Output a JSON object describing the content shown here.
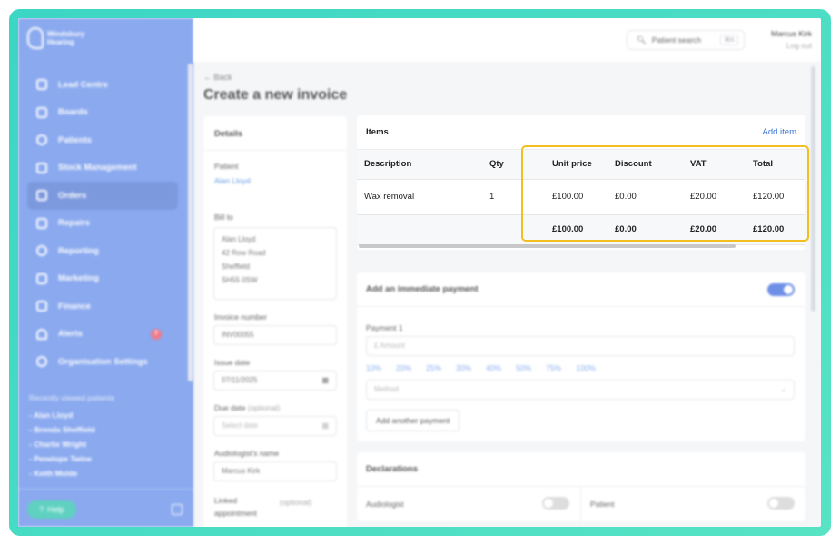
{
  "brand": {
    "name": "Windsbury Hearing",
    "line1": "Windsbury",
    "line2": "Hearing"
  },
  "colors": {
    "sidebar": "#8aa9ef",
    "accent": "#3b73d6",
    "highlight": "#f2c01e",
    "frame": "#3cd6c4"
  },
  "sidebar": {
    "items": [
      {
        "label": "Lead Centre",
        "icon": "headset-icon"
      },
      {
        "label": "Boards",
        "icon": "board-icon"
      },
      {
        "label": "Patients",
        "icon": "smile-icon"
      },
      {
        "label": "Stock Management",
        "icon": "box-icon"
      },
      {
        "label": "Orders",
        "icon": "calendar-icon",
        "active": true
      },
      {
        "label": "Repairs",
        "icon": "wrench-icon"
      },
      {
        "label": "Reporting",
        "icon": "pie-icon"
      },
      {
        "label": "Marketing",
        "icon": "mail-icon"
      },
      {
        "label": "Finance",
        "icon": "card-icon"
      },
      {
        "label": "Alerts",
        "icon": "bell-icon",
        "badge": "7"
      },
      {
        "label": "Organisation Settings",
        "icon": "gear-icon"
      }
    ],
    "recent_heading": "Recently viewed patients",
    "recent": [
      "- Alan Lloyd",
      "- Brenda Sheffield",
      "- Charlie Wright",
      "- Penelope Twine",
      "- Keith Molde"
    ],
    "help_label": "Help"
  },
  "header": {
    "search_label": "Patient search",
    "search_shortcut": "⌘K",
    "user_name": "Marcus Kirk",
    "logout_label": "Log out"
  },
  "page": {
    "back_label": "Back",
    "title": "Create a new invoice"
  },
  "details": {
    "heading": "Details",
    "patient_label": "Patient",
    "patient_value": "Alan Lloyd",
    "bill_to_label": "Bill to",
    "bill_to_lines": [
      "Alan Lloyd",
      "42 Row Road",
      "Sheffield",
      "SH55 0SW"
    ],
    "invoice_number_label": "Invoice number",
    "invoice_number": "INV00055",
    "issue_date_label": "Issue date",
    "issue_date": "07/11/2025",
    "due_date_label": "Due date",
    "due_date_optional": "(optional)",
    "due_date_placeholder": "Select date",
    "audiologist_label": "Audiologist's name",
    "audiologist": "Marcus Kirk",
    "linked_label": "Linked appointment",
    "linked_optional": "(optional)"
  },
  "items": {
    "heading": "Items",
    "add_label": "Add item",
    "columns": [
      "Description",
      "Qty",
      "Unit price",
      "Discount",
      "VAT",
      "Total"
    ],
    "rows": [
      {
        "description": "Wax removal",
        "qty": "1",
        "unit_price": "£100.00",
        "discount": "£0.00",
        "vat": "£20.00",
        "total": "£120.00"
      }
    ],
    "totals": {
      "unit_price": "£100.00",
      "discount": "£0.00",
      "vat": "£20.00",
      "total": "£120.00"
    }
  },
  "payment": {
    "heading": "Add an immediate payment",
    "enabled": true,
    "payment_label": "Payment 1",
    "currency": "£",
    "amount_placeholder": "Amount",
    "percentages": [
      "10%",
      "20%",
      "25%",
      "30%",
      "40%",
      "50%",
      "75%",
      "100%"
    ],
    "method_placeholder": "Method",
    "add_another_label": "Add another payment"
  },
  "declarations": {
    "heading": "Declarations",
    "audiologist_label": "Audiologist",
    "patient_label": "Patient"
  }
}
